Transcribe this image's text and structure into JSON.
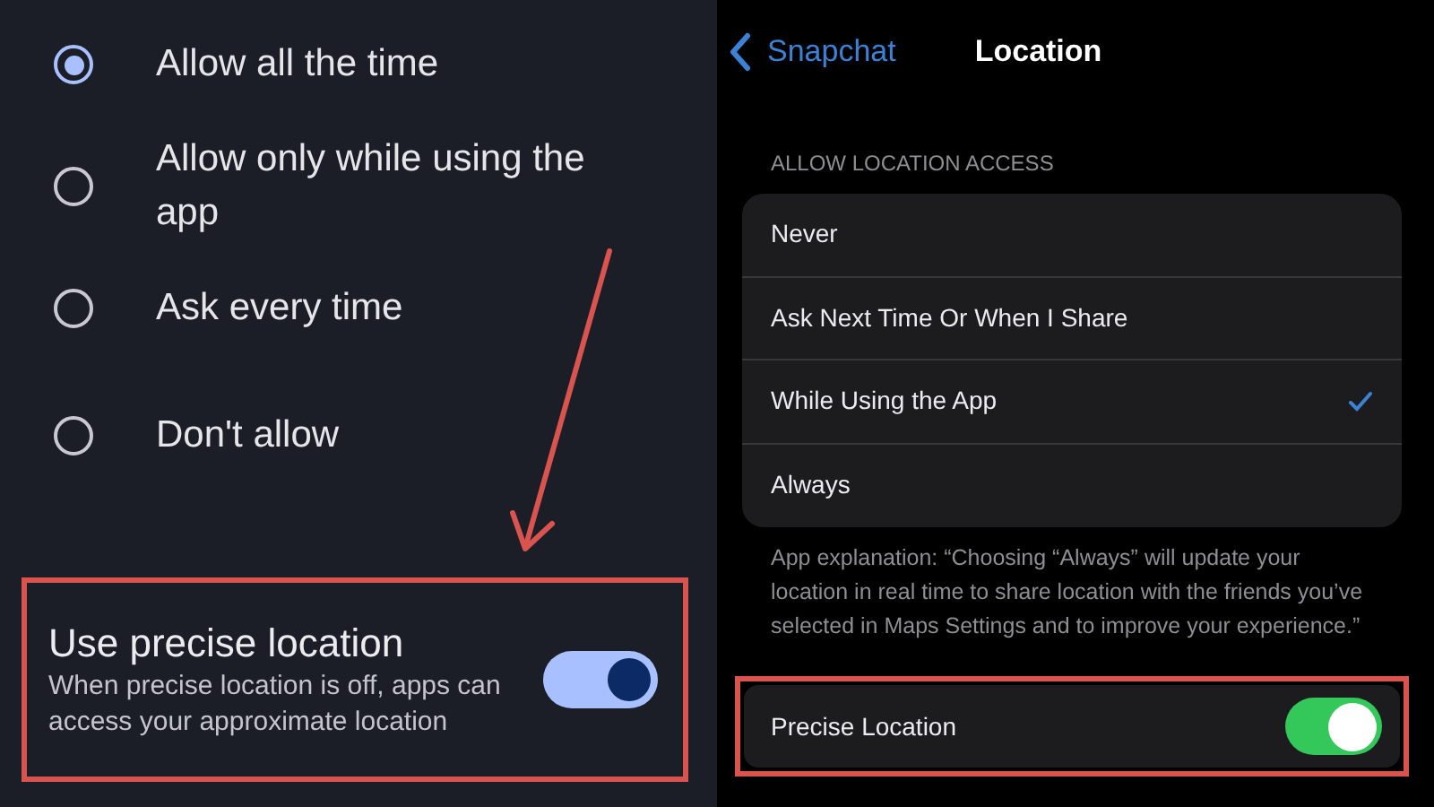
{
  "android": {
    "options": [
      {
        "label": "Allow all the time",
        "selected": true
      },
      {
        "label": "Allow only while using the app",
        "selected": false
      },
      {
        "label": "Ask every time",
        "selected": false
      },
      {
        "label": "Don't allow",
        "selected": false
      }
    ],
    "precise": {
      "title": "Use precise location",
      "description": "When precise location is off, apps can access your approximate location",
      "on": true
    }
  },
  "ios": {
    "nav": {
      "back": "Snapchat",
      "title": "Location"
    },
    "section_header": "ALLOW LOCATION ACCESS",
    "options": [
      {
        "label": "Never",
        "selected": false
      },
      {
        "label": "Ask Next Time Or When I Share",
        "selected": false
      },
      {
        "label": "While Using the App",
        "selected": true
      },
      {
        "label": "Always",
        "selected": false
      }
    ],
    "explanation": "App explanation: “Choosing “Always” will update your location in real time to share location with the friends you’ve selected in Maps Settings and to improve your experience.”",
    "precise": {
      "label": "Precise Location",
      "on": true
    }
  }
}
